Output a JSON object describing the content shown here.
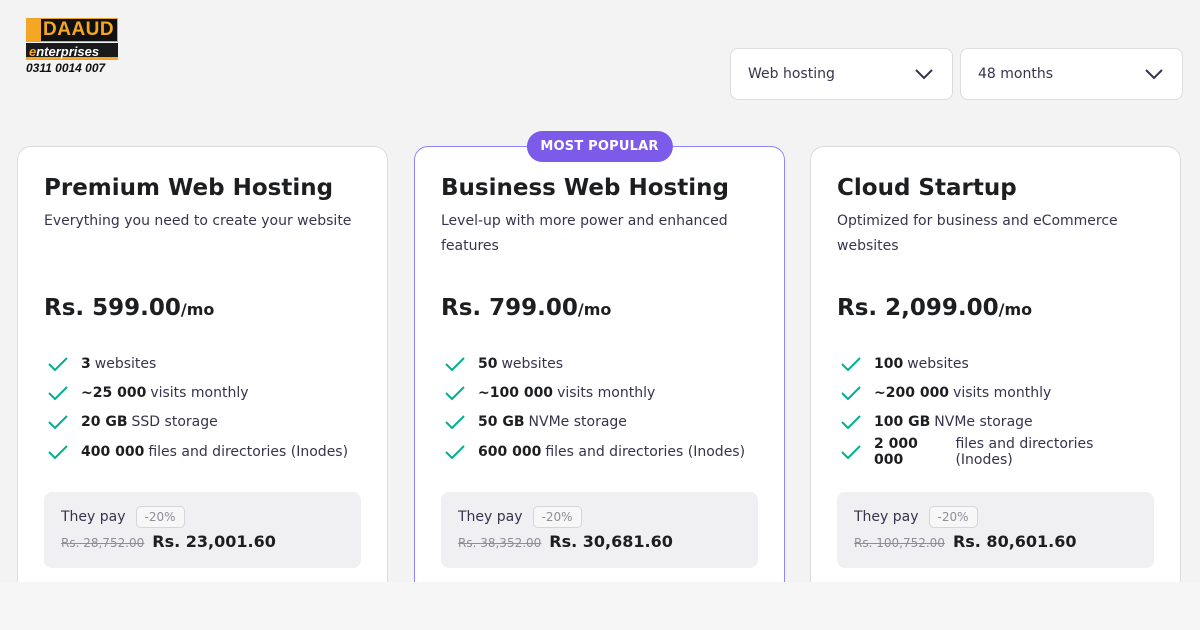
{
  "logo": {
    "brand": "DAAUD",
    "sub_e": "e",
    "sub_rest": "nterprises",
    "phone": "0311 0014 007"
  },
  "filters": {
    "product": {
      "value": "Web hosting",
      "icon": "chevron-down-icon"
    },
    "period": {
      "value": "48 months",
      "icon": "chevron-down-icon"
    }
  },
  "colors": {
    "accent": "#7d5bea",
    "check": "#00b090",
    "popular_border": "#8c85ff"
  },
  "plans": [
    {
      "title": "Premium Web Hosting",
      "description": "Everything you need to create your website",
      "price": "Rs. 599.00",
      "per": "/mo",
      "features": [
        {
          "bold": "3",
          "text": "websites"
        },
        {
          "bold": "~25 000",
          "text": "visits monthly"
        },
        {
          "bold": "20 GB",
          "text": "SSD storage"
        },
        {
          "bold": "400 000",
          "text": "files and directories (Inodes)"
        }
      ],
      "they_pay": "They pay",
      "discount": "-20%",
      "old_price": "Rs. 28,752.00",
      "new_price": "Rs. 23,001.60"
    },
    {
      "badge": "MOST POPULAR",
      "title": "Business Web Hosting",
      "description": "Level-up with more power and enhanced features",
      "price": "Rs. 799.00",
      "per": "/mo",
      "features": [
        {
          "bold": "50",
          "text": "websites"
        },
        {
          "bold": "~100 000",
          "text": "visits monthly"
        },
        {
          "bold": "50 GB",
          "text": "NVMe storage"
        },
        {
          "bold": "600 000",
          "text": "files and directories (Inodes)"
        }
      ],
      "they_pay": "They pay",
      "discount": "-20%",
      "old_price": "Rs. 38,352.00",
      "new_price": "Rs. 30,681.60"
    },
    {
      "title": "Cloud Startup",
      "description": "Optimized for business and eCommerce websites",
      "price": "Rs. 2,099.00",
      "per": "/mo",
      "features": [
        {
          "bold": "100",
          "text": "websites"
        },
        {
          "bold": "~200 000",
          "text": "visits monthly"
        },
        {
          "bold": "100 GB",
          "text": "NVMe storage"
        },
        {
          "bold": "2 000 000",
          "text": "files and directories (Inodes)"
        }
      ],
      "they_pay": "They pay",
      "discount": "-20%",
      "old_price": "Rs. 100,752.00",
      "new_price": "Rs. 80,601.60"
    }
  ]
}
